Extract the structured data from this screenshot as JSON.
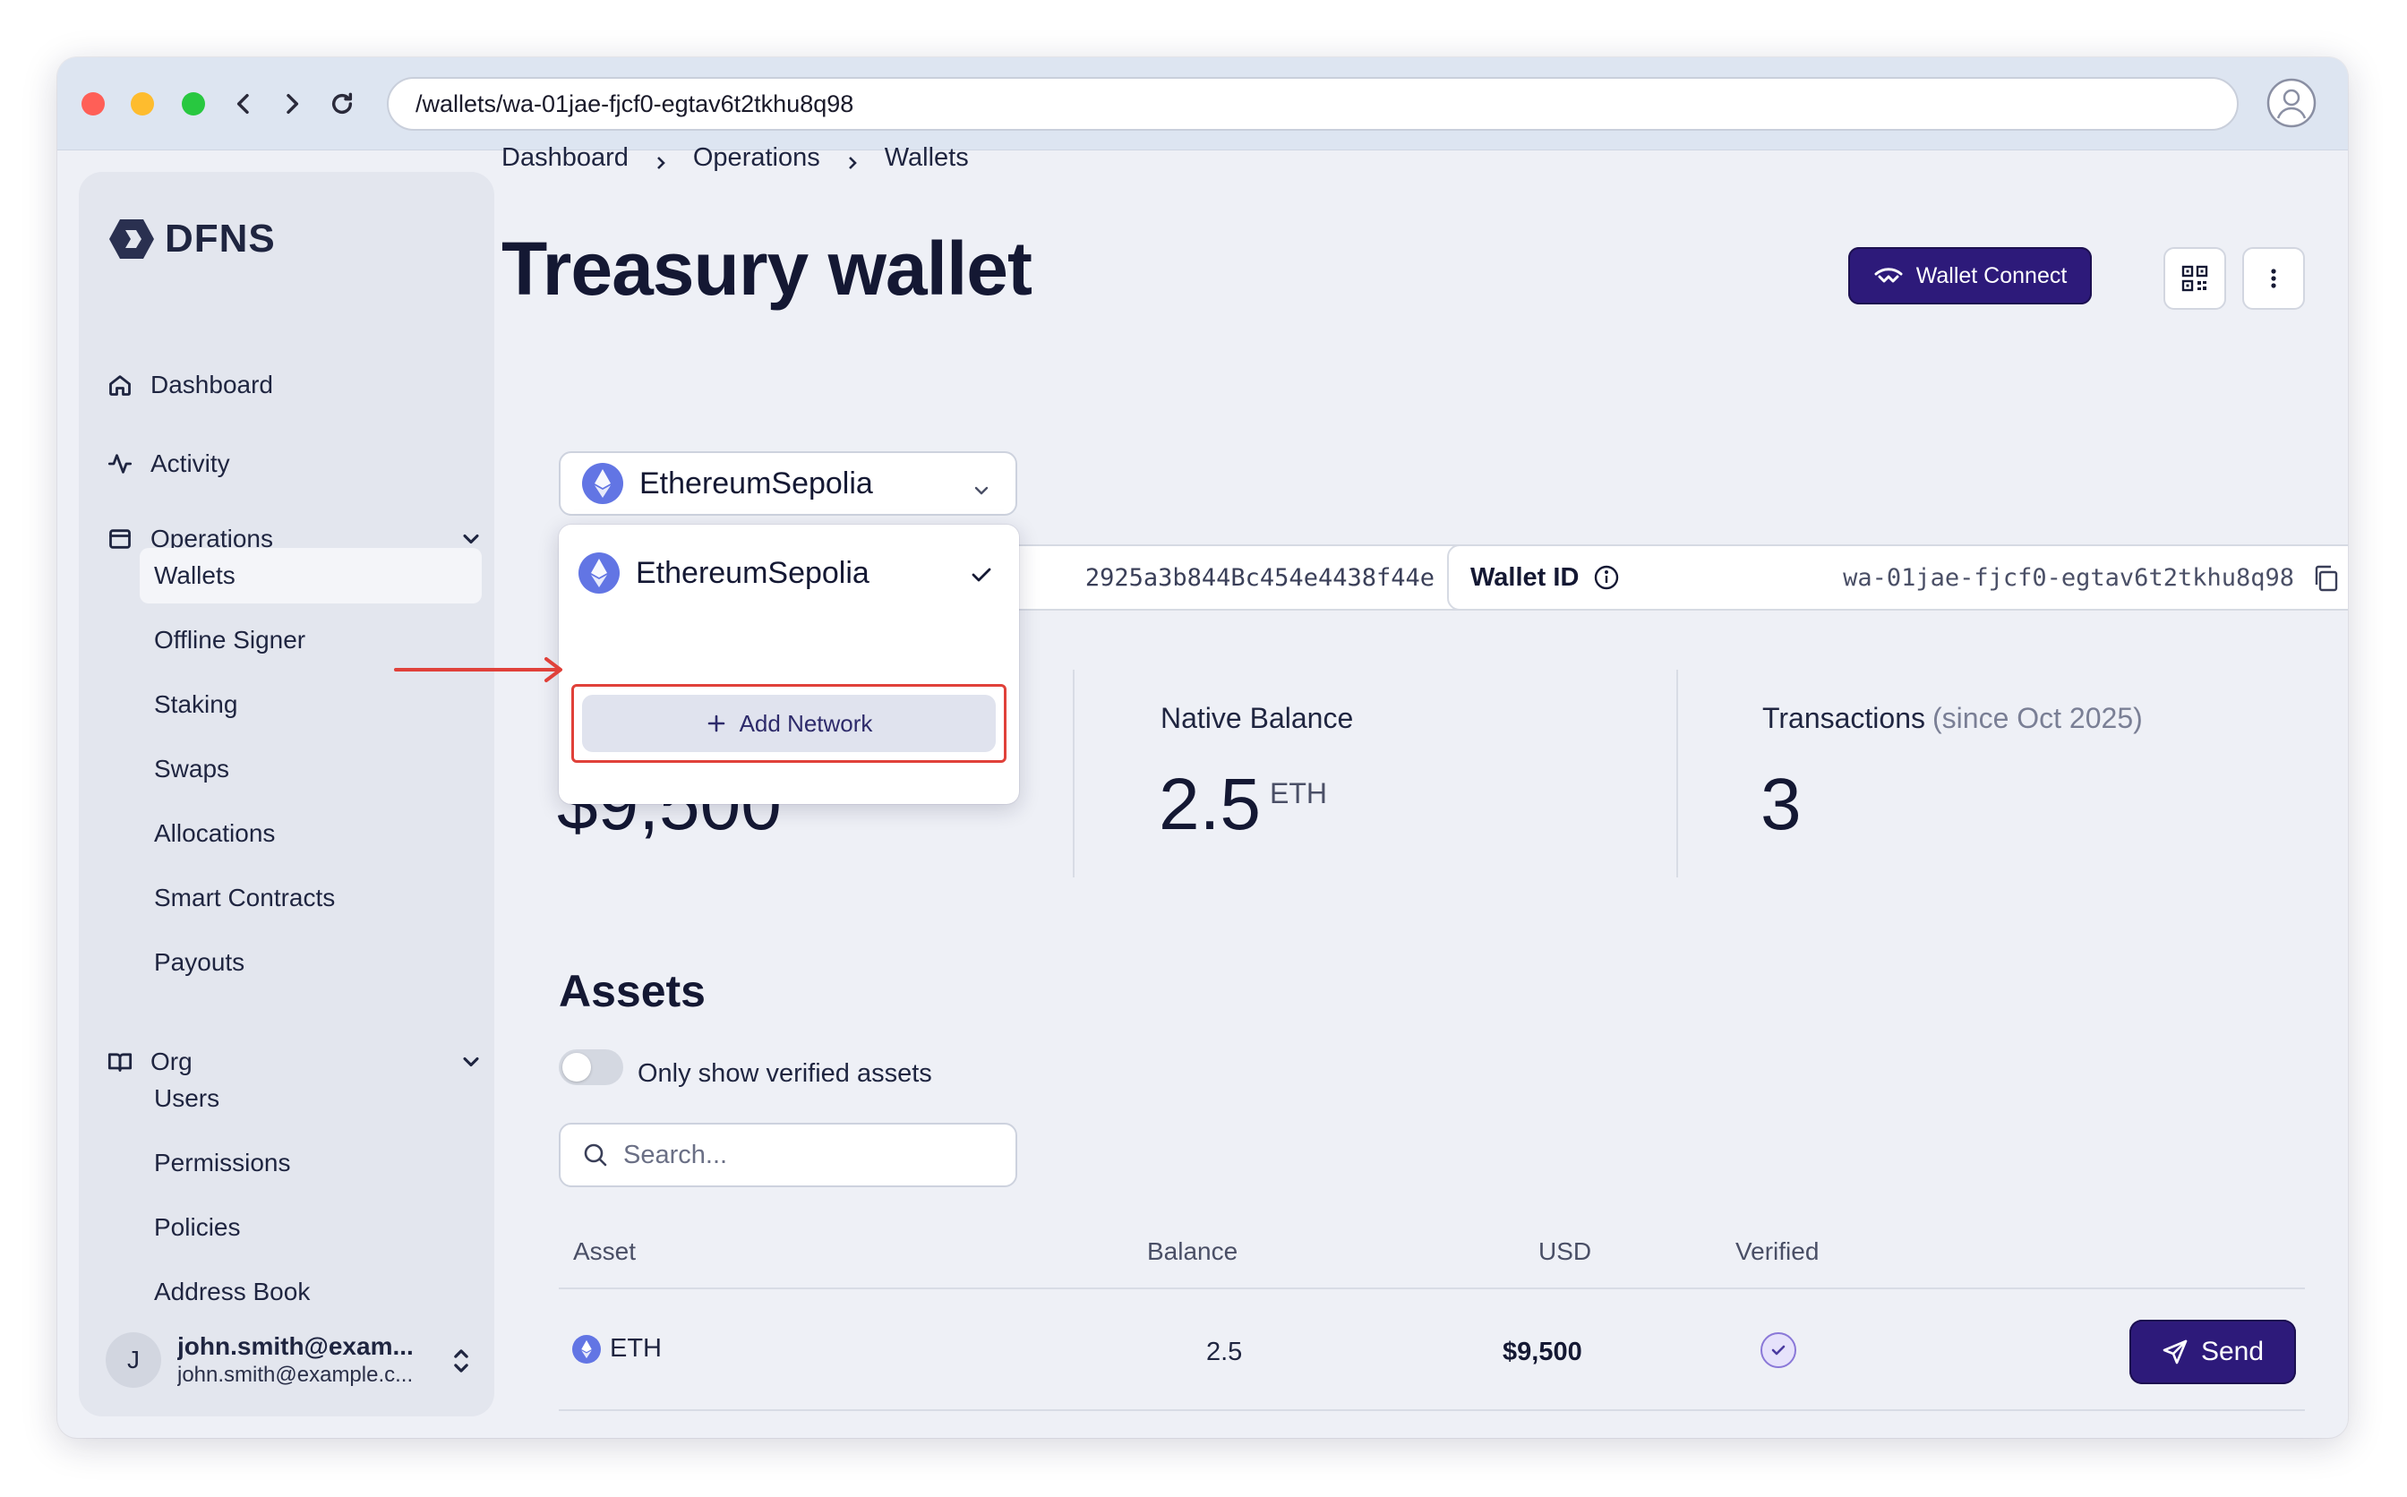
{
  "browser": {
    "url": "/wallets/wa-01jae-fjcf0-egtav6t2tkhu8q98"
  },
  "sidebar": {
    "logo": "DFNS",
    "nav": [
      {
        "label": "Dashboard",
        "icon": "home-icon"
      },
      {
        "label": "Activity",
        "icon": "activity-icon"
      },
      {
        "label": "Operations",
        "icon": "wallet-icon"
      }
    ],
    "operations_items": [
      "Wallets",
      "Offline Signer",
      "Staking",
      "Swaps",
      "Allocations",
      "Smart Contracts",
      "Payouts"
    ],
    "org": {
      "label": "Org",
      "icon": "book-icon"
    },
    "org_items": [
      "Users",
      "Permissions",
      "Policies",
      "Address Book"
    ],
    "user": {
      "initial": "J",
      "name": "john.smith@exam...",
      "email": "john.smith@example.c..."
    }
  },
  "breadcrumb": [
    "Dashboard",
    "Operations",
    "Wallets"
  ],
  "page": {
    "title": "Treasury wallet",
    "wallet_connect_label": "Wallet Connect"
  },
  "network_select": {
    "selected": "EthereumSepolia",
    "options": [
      "EthereumSepolia"
    ],
    "add_network_label": "Add Network"
  },
  "address": {
    "value": "2925a3b844Bc454e4438f44e"
  },
  "wallet_id": {
    "label": "Wallet ID",
    "value": "wa-01jae-fjcf0-egtav6t2tkhu8q98"
  },
  "stats": {
    "usd_value": "$9,500",
    "native_balance_label": "Native Balance",
    "native_balance_value": "2.5",
    "native_balance_unit": "ETH",
    "transactions_label": "Transactions",
    "transactions_since": "(since Oct 2025)",
    "transactions_value": "3"
  },
  "assets": {
    "title": "Assets",
    "toggle_label": "Only show verified assets",
    "toggle_on": false,
    "search_placeholder": "Search...",
    "columns": [
      "Asset",
      "Balance",
      "USD",
      "Verified"
    ],
    "rows": [
      {
        "asset": "ETH",
        "balance": "2.5",
        "usd": "$9,500",
        "verified": true,
        "action": "Send"
      }
    ]
  },
  "colors": {
    "primary": "#2d1a7a",
    "eth": "#6275e4",
    "highlight": "#e0413a",
    "background": "#eef0f6"
  }
}
